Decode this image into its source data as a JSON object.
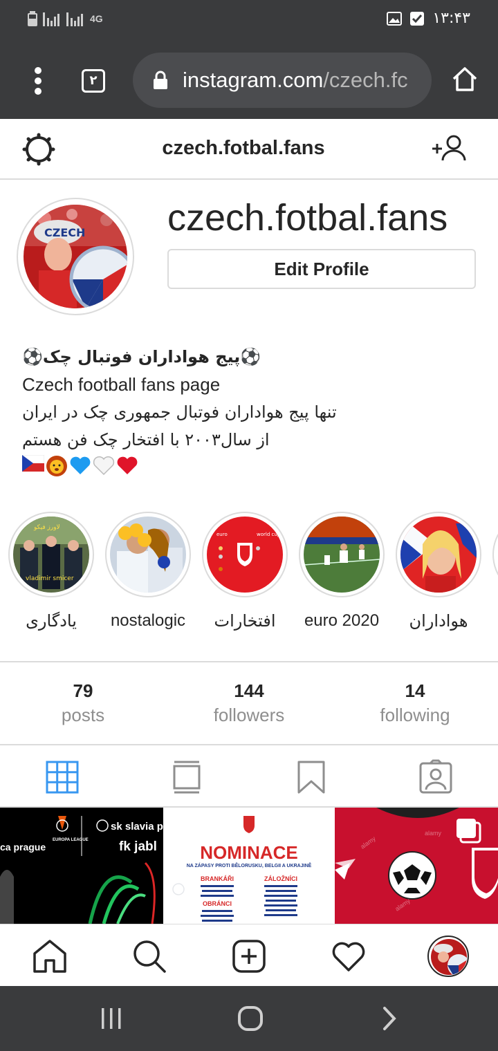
{
  "status_bar": {
    "network": "4G",
    "time": "۱۳:۴۳"
  },
  "browser": {
    "tab_count": "۲",
    "url_host": "instagram.com",
    "url_path": "/czech.fc"
  },
  "header": {
    "title": "czech.fotbal.fans"
  },
  "profile": {
    "username": "czech.fotbal.fans",
    "edit_button": "Edit Profile",
    "bio": {
      "line1": "⚽پیج هواداران فوتبال چک⚽",
      "line2": "Czech football fans page",
      "line3": "تنها پیج هواداران فوتبال جمهوری چک در ایران",
      "line4": "از سال۲۰۰۳ با افتخار چک فن هستم"
    }
  },
  "highlights": [
    {
      "label": "یادگاری",
      "caption": "vladimir smicer"
    },
    {
      "label": "nostalogic"
    },
    {
      "label": "افتخارات",
      "caption_left": "euro",
      "caption_right": "world cup"
    },
    {
      "label": "euro 2020"
    },
    {
      "label": "هواداران"
    }
  ],
  "stats": {
    "posts": {
      "value": "79",
      "label": "posts"
    },
    "followers": {
      "value": "144",
      "label": "followers"
    },
    "following": {
      "value": "14",
      "label": "following"
    }
  },
  "grid": {
    "post1_text_a": "ca prague",
    "post1_text_b": "sk slavia p",
    "post1_text_c": "fk jabl",
    "post1_logo": "EUROPA LEAGUE",
    "post2_title": "NOMINACE",
    "post2_sub": "NA ZÁPASY PROTI BĚLORUSKU, BELGII A UKRAJINĚ",
    "post2_col1": "BRANKÁŘI",
    "post2_col2": "ZÁLOŽNÍCI",
    "post2_col1b": "OBRÁNCI"
  },
  "colors": {
    "accent": "#3897f0",
    "border": "#dbdbdb",
    "text": "#262626",
    "muted": "#8e8e8e",
    "system_bar": "#3a3b3d"
  }
}
